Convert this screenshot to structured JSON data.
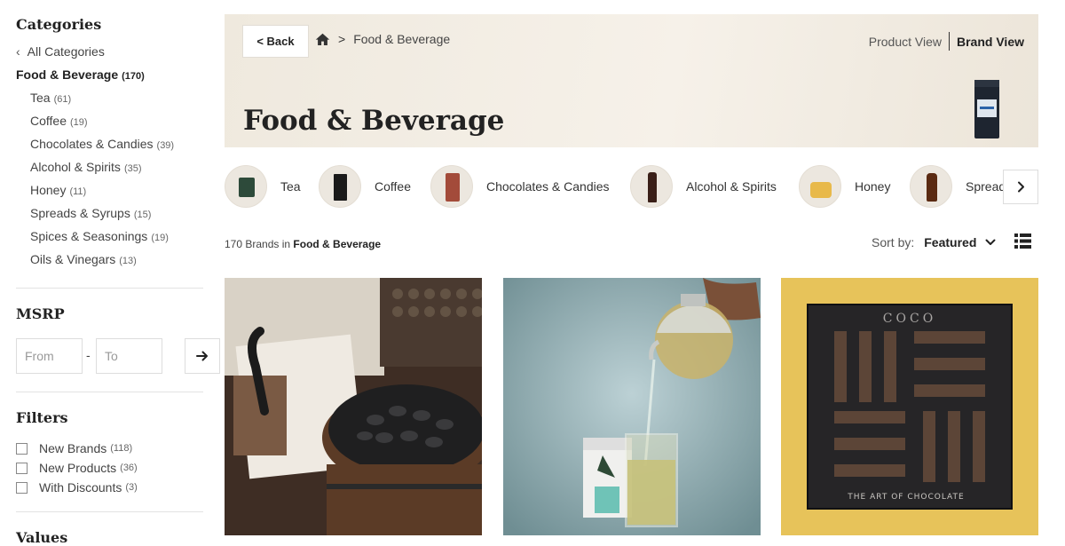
{
  "sidebar": {
    "categories_title": "Categories",
    "all_categories": "All Categories",
    "current": {
      "label": "Food & Beverage",
      "count": "(170)"
    },
    "subcategories": [
      {
        "label": "Tea",
        "count": "(61)"
      },
      {
        "label": "Coffee",
        "count": "(19)"
      },
      {
        "label": "Chocolates & Candies",
        "count": "(39)"
      },
      {
        "label": "Alcohol & Spirits",
        "count": "(35)"
      },
      {
        "label": "Honey",
        "count": "(11)"
      },
      {
        "label": "Spreads & Syrups",
        "count": "(15)"
      },
      {
        "label": "Spices & Seasonings",
        "count": "(19)"
      },
      {
        "label": "Oils & Vinegars",
        "count": "(13)"
      }
    ],
    "msrp_title": "MSRP",
    "msrp_from_placeholder": "From",
    "msrp_to_placeholder": "To",
    "msrp_dash": "-",
    "filters_title": "Filters",
    "filters": [
      {
        "label": "New Brands",
        "count": "(118)",
        "checked": false
      },
      {
        "label": "New Products",
        "count": "(36)",
        "checked": false
      },
      {
        "label": "With Discounts",
        "count": "(3)",
        "checked": false
      }
    ],
    "values_title": "Values"
  },
  "banner": {
    "back_label": "< Back",
    "breadcrumb_sep": ">",
    "breadcrumb_current": "Food & Beverage",
    "product_view": "Product View",
    "brand_view": "Brand View",
    "title": "Food & Beverage"
  },
  "category_strip": [
    {
      "label": "Tea",
      "icon": "tea-tin-icon"
    },
    {
      "label": "Coffee",
      "icon": "coffee-bag-icon"
    },
    {
      "label": "Chocolates & Candies",
      "icon": "chocolate-bag-icon"
    },
    {
      "label": "Alcohol & Spirits",
      "icon": "bottle-icon"
    },
    {
      "label": "Honey",
      "icon": "honey-jar-icon"
    },
    {
      "label": "Spreads & Syrups",
      "icon": "syrup-bottle-icon"
    }
  ],
  "results": {
    "count_text": "170 Brands in",
    "category": "Food & Beverage"
  },
  "sort": {
    "label": "Sort by:",
    "value": "Featured"
  },
  "products": [
    {
      "name": "coffee beans barrel photo"
    },
    {
      "name": "tea pouring photo"
    },
    {
      "name": "coco chocolate box photo",
      "brand_text": "COCO",
      "tagline": "THE ART OF CHOCOLATE"
    }
  ],
  "colors": {
    "banner_bg": "#efe9de",
    "card3_bg": "#e7c35a"
  }
}
